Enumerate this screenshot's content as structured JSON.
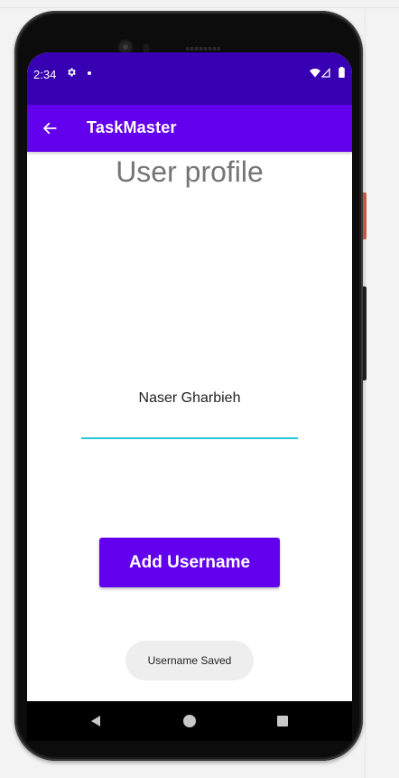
{
  "status_bar": {
    "time": "2:34",
    "icons": [
      "gear-icon",
      "notification-dot-icon",
      "wifi-icon",
      "signal-icon",
      "battery-icon"
    ],
    "color": "#3700b3"
  },
  "app_bar": {
    "title": "TaskMaster",
    "back_icon": "arrow-back-icon",
    "color": "#6200ee"
  },
  "main": {
    "page_title": "User profile",
    "username_value": "Naser Gharbieh",
    "underline_color": "#26c6da",
    "add_button_label": "Add Username",
    "button_color": "#6200ee"
  },
  "toast": {
    "text": "Username Saved"
  },
  "nav_bar": {
    "icons": [
      "nav-back-icon",
      "nav-home-icon",
      "nav-recents-icon"
    ]
  }
}
